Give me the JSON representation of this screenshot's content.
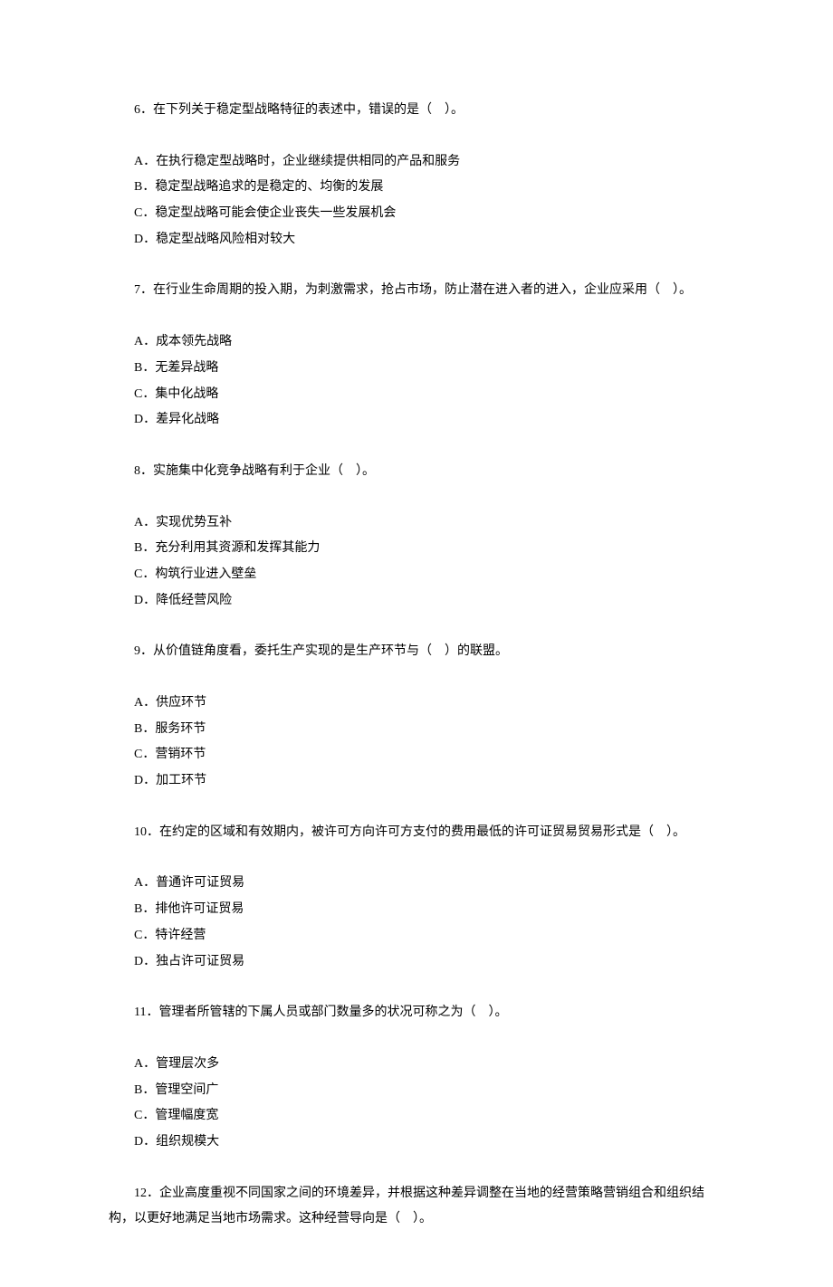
{
  "questions": [
    {
      "stem": "6．在下列关于稳定型战略特征的表述中，错误的是（　）。",
      "options": [
        "A．在执行稳定型战略时，企业继续提供相同的产品和服务",
        "B．稳定型战略追求的是稳定的、均衡的发展",
        "C．稳定型战略可能会使企业丧失一些发展机会",
        "D．稳定型战略风险相对较大"
      ]
    },
    {
      "stem": "7．在行业生命周期的投入期，为刺激需求，抢占市场，防止潜在进入者的进入，企业应采用（　）。",
      "options": [
        "A．成本领先战略",
        "B．无差异战略",
        "C．集中化战略",
        "D．差异化战略"
      ]
    },
    {
      "stem": "8．实施集中化竞争战略有利于企业（　）。",
      "options": [
        "A．实现优势互补",
        "B．充分利用其资源和发挥其能力",
        "C．构筑行业进入壁垒",
        "D．降低经营风险"
      ]
    },
    {
      "stem": "9．从价值链角度看，委托生产实现的是生产环节与（　）的联盟。",
      "options": [
        "A．供应环节",
        "B．服务环节",
        "C．营销环节",
        "D．加工环节"
      ]
    },
    {
      "stem": "10．在约定的区域和有效期内，被许可方向许可方支付的费用最低的许可证贸易贸易形式是（　）。",
      "options": [
        "A．普通许可证贸易",
        "B．排他许可证贸易",
        "C．特许经营",
        "D．独占许可证贸易"
      ]
    },
    {
      "stem": "11．管理者所管辖的下属人员或部门数量多的状况可称之为（　）。",
      "options": [
        "A．管理层次多",
        "B．管理空间广",
        "C．管理幅度宽",
        "D．组织规模大"
      ]
    },
    {
      "stem": "12．企业高度重视不同国家之间的环境差异，并根据这种差异调整在当地的经营策略营销组合和组织结构，以更好地满足当地市场需求。这种经营导向是（　）。",
      "options": []
    }
  ]
}
